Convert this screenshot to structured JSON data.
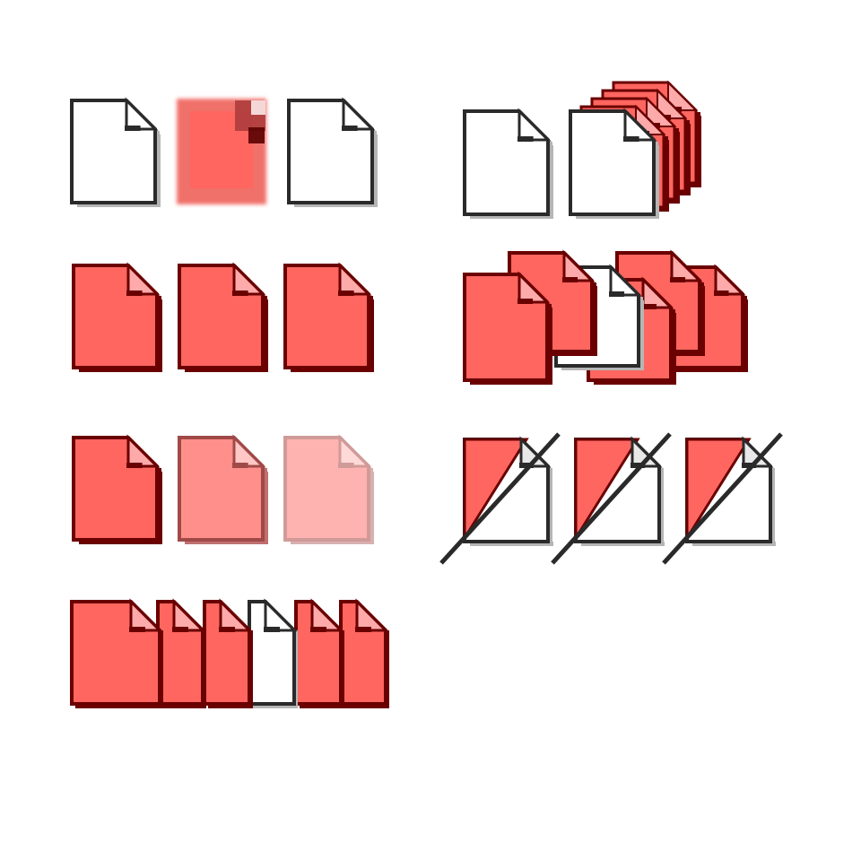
{
  "colors": {
    "red": "#ff6660",
    "red_dark": "#6a0000",
    "red_fold": "#ffaaaa",
    "white": "#ffffff",
    "outline": "#2a2a2a",
    "shadow": "#b5b5b5",
    "red_light": "#ff8f8a",
    "red_lighter": "#ffb3b0"
  },
  "icon_groups": [
    {
      "name": "document-icons-neutral-row",
      "icons": [
        "document-outline-icon",
        "document-blurred-red-icon",
        "document-outline-icon"
      ]
    },
    {
      "name": "document-icons-stack",
      "icons": [
        "document-outline-icon",
        "document-stack-icon"
      ]
    },
    {
      "name": "document-icons-red-row",
      "icons": [
        "document-red-icon",
        "document-red-icon",
        "document-red-icon"
      ]
    },
    {
      "name": "document-icons-scattered",
      "icons": [
        "document-scattered-group-icon"
      ]
    },
    {
      "name": "document-icons-fading",
      "icons": [
        "document-red-icon",
        "document-faded-icon",
        "document-very-faded-icon"
      ]
    },
    {
      "name": "document-icons-crossed",
      "icons": [
        "document-crossed-icon",
        "document-crossed-icon",
        "document-crossed-icon"
      ]
    },
    {
      "name": "document-icons-overlapping-row",
      "icons": [
        "document-overlapping-row-icon"
      ]
    }
  ]
}
